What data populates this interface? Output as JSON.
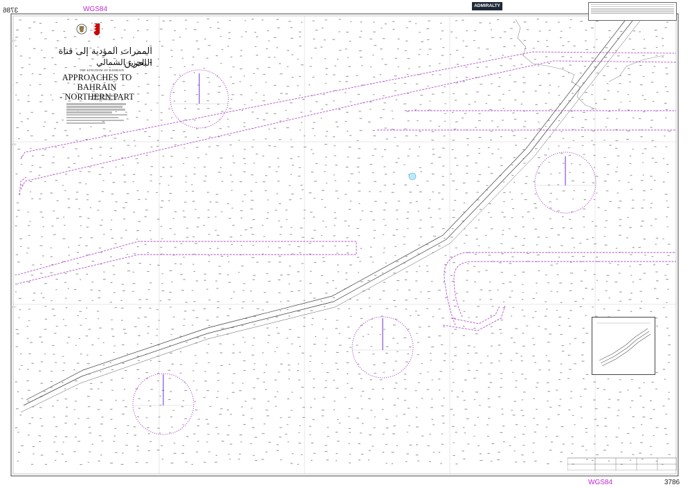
{
  "chart_number": "3786",
  "datum": "WGS84",
  "title_arabic": "الممرات المؤدية إلى قناة البحرين",
  "subtitle_arabic": "- الجزء الشمالي",
  "kingdom": "THE KINGDOM OF BAHRAIN",
  "title_line1": "APPROACHES TO BAHRAIN",
  "title_line2": "- NORTHERN PART",
  "depths_line1": "DEPTHS IN METRES",
  "depths_line2": "SCALE 1:75 000 at lat 26°",
  "publisher": "ADMIRALTY",
  "colors": {
    "boundary": "#b64fcf",
    "channel": "#3a3a3a",
    "soundings": "#9a9a9a",
    "grid": "#cfcfcf",
    "coast": "#8c8c8c"
  }
}
